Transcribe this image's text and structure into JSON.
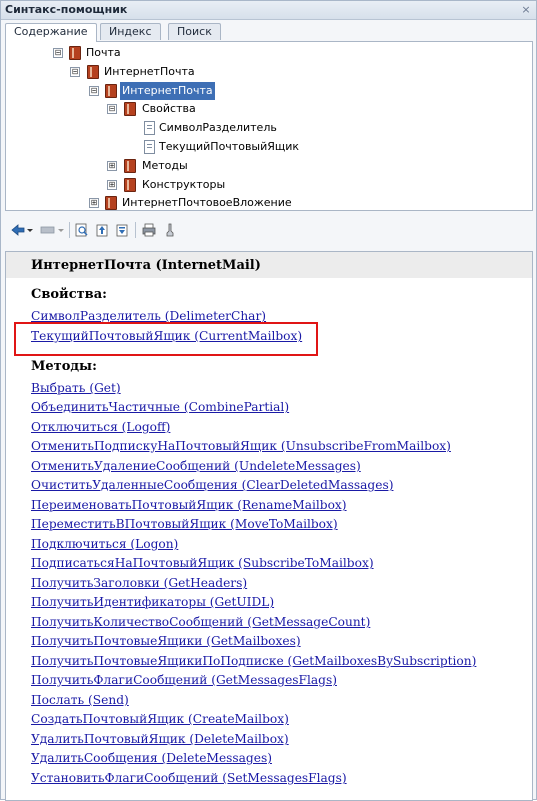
{
  "window": {
    "title": "Синтакс-помощник",
    "close_glyph": "×"
  },
  "tabs": [
    "Содержание",
    "Индекс",
    "Поиск"
  ],
  "tree": {
    "items": [
      {
        "label": "Почта",
        "expander": "⊟",
        "icon": "book-icon",
        "selected": false
      },
      {
        "label": "ИнтернетПочта",
        "expander": "⊟",
        "icon": "book-icon",
        "selected": false
      },
      {
        "label": "ИнтернетПочта",
        "expander": "⊟",
        "icon": "book-icon",
        "selected": true
      },
      {
        "label": "Свойства",
        "expander": "⊟",
        "icon": "book-icon",
        "selected": false
      },
      {
        "label": "СимволРазделитель",
        "expander": "",
        "icon": "page-icon",
        "selected": false
      },
      {
        "label": "ТекущийПочтовыйЯщик",
        "expander": "",
        "icon": "page-icon",
        "selected": false
      },
      {
        "label": "Методы",
        "expander": "⊞",
        "icon": "book-icon",
        "selected": false
      },
      {
        "label": "Конструкторы",
        "expander": "⊞",
        "icon": "book-icon",
        "selected": false
      },
      {
        "label": "ИнтернетПочтовоеВложение",
        "expander": "⊞",
        "icon": "book-icon",
        "selected": false
      }
    ]
  },
  "toolbar": {
    "buttons": [
      "back-icon",
      "dropdown-arrow-icon",
      "forward-icon",
      "dropdown-arrow-icon",
      "find-in-tree-icon",
      "move-up-icon",
      "move-to-top-icon",
      "print-icon",
      "settings-icon"
    ]
  },
  "content": {
    "title": "ИнтернетПочта (InternetMail)",
    "properties_heading": "Свойства:",
    "properties": [
      "СимволРазделитель (DelimeterChar)",
      "ТекущийПочтовыйЯщик (CurrentMailbox)"
    ],
    "methods_heading": "Методы:",
    "methods": [
      "Выбрать (Get)",
      "ОбъединитьЧастичные (CombinePartial)",
      "Отключиться (Logoff)",
      "ОтменитьПодпискуНаПочтовыйЯщик (UnsubscribeFromMailbox)",
      "ОтменитьУдалениеСообщений (UndeleteMessages)",
      "ОчиститьУдаленныеСообщения (ClearDeletedMassages)",
      "ПереименоватьПочтовыйЯщик (RenameMailbox)",
      "ПереместитьВПочтовыйЯщик (MoveToMailbox)",
      "Подключиться (Logon)",
      "ПодписатьсяНаПочтовыйЯщик (SubscribeToMailbox)",
      "ПолучитьЗаголовки (GetHeaders)",
      "ПолучитьИдентификаторы (GetUIDL)",
      "ПолучитьКоличествоСообщений (GetMessageCount)",
      "ПолучитьПочтовыеЯщики (GetMailboxes)",
      "ПолучитьПочтовыеЯщикиПоПодписке (GetMailboxesBySubscription)",
      "ПолучитьФлагиСообщений (GetMessagesFlags)",
      "Послать (Send)",
      "СоздатьПочтовыйЯщик (CreateMailbox)",
      "УдалитьПочтовыйЯщик (DeleteMailbox)",
      "УдалитьСообщения (DeleteMessages)",
      "УстановитьФлагиСообщений (SetMessagesFlags)"
    ]
  },
  "colors": {
    "link": "#1a1aa6",
    "highlight": "#e01515",
    "selection": "#3e6fb5"
  }
}
